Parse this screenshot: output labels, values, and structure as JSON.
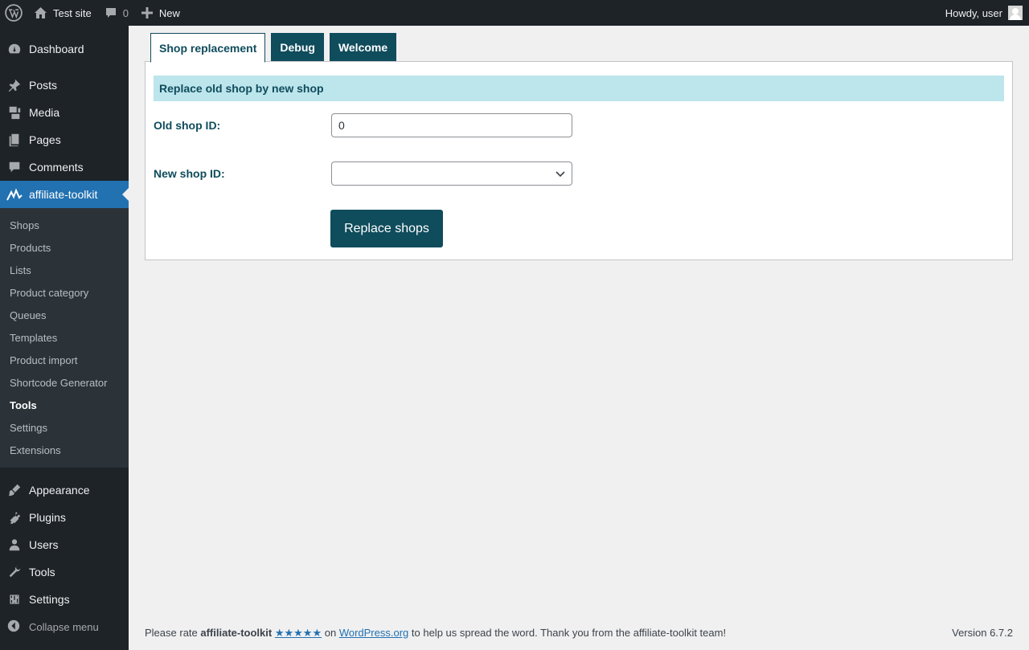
{
  "adminbar": {
    "site_name": "Test site",
    "comments_count": "0",
    "new_label": "New",
    "howdy": "Howdy, user"
  },
  "sidebar": {
    "items": [
      {
        "label": "Dashboard",
        "icon": "dashboard-icon"
      },
      {
        "label": "Posts",
        "icon": "pin-icon"
      },
      {
        "label": "Media",
        "icon": "media-icon"
      },
      {
        "label": "Pages",
        "icon": "pages-icon"
      },
      {
        "label": "Comments",
        "icon": "comment-icon"
      },
      {
        "label": "affiliate-toolkit",
        "icon": "affiliate-toolkit-icon"
      }
    ],
    "submenu": [
      "Shops",
      "Products",
      "Lists",
      "Product category",
      "Queues",
      "Templates",
      "Product import",
      "Shortcode Generator",
      "Tools",
      "Settings",
      "Extensions"
    ],
    "lower_items": [
      {
        "label": "Appearance",
        "icon": "brush-icon"
      },
      {
        "label": "Plugins",
        "icon": "plugin-icon"
      },
      {
        "label": "Users",
        "icon": "users-icon"
      },
      {
        "label": "Tools",
        "icon": "wrench-icon"
      },
      {
        "label": "Settings",
        "icon": "settings-icon"
      }
    ],
    "collapse_label": "Collapse menu"
  },
  "tabs": [
    "Shop replacement",
    "Debug",
    "Welcome"
  ],
  "panel": {
    "heading": "Replace old shop by new shop",
    "old_label": "Old shop ID:",
    "old_value": "0",
    "new_label": "New shop ID:",
    "new_value": "",
    "button": "Replace shops"
  },
  "footer": {
    "text1": "Please rate ",
    "plugin": "affiliate-toolkit",
    "stars": "★★★★★",
    "text2": " on ",
    "link": "WordPress.org",
    "text3": " to help us spread the word. Thank you from the affiliate-toolkit team!",
    "version": "Version 6.7.2"
  }
}
